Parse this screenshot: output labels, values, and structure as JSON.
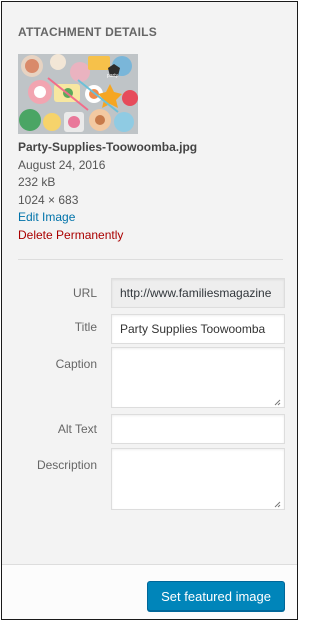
{
  "section_title": "Attachment Details",
  "thumbnail": {
    "icon": "image-thumbnail"
  },
  "file": {
    "name": "Party-Supplies-Toowoomba.jpg",
    "date": "August 24, 2016",
    "size": "232 kB",
    "dimensions": "1024 × 683"
  },
  "actions": {
    "edit_label": "Edit Image",
    "delete_label": "Delete Permanently"
  },
  "fields": {
    "url": {
      "label": "URL",
      "value": "http://www.familiesmagazine"
    },
    "title": {
      "label": "Title",
      "value": "Party Supplies Toowoomba"
    },
    "caption": {
      "label": "Caption",
      "value": ""
    },
    "alt_text": {
      "label": "Alt Text",
      "value": ""
    },
    "description": {
      "label": "Description",
      "value": ""
    }
  },
  "footer": {
    "button_label": "Set featured image"
  },
  "colors": {
    "accent": "#0085ba",
    "link": "#0073aa",
    "danger": "#aa0000"
  }
}
